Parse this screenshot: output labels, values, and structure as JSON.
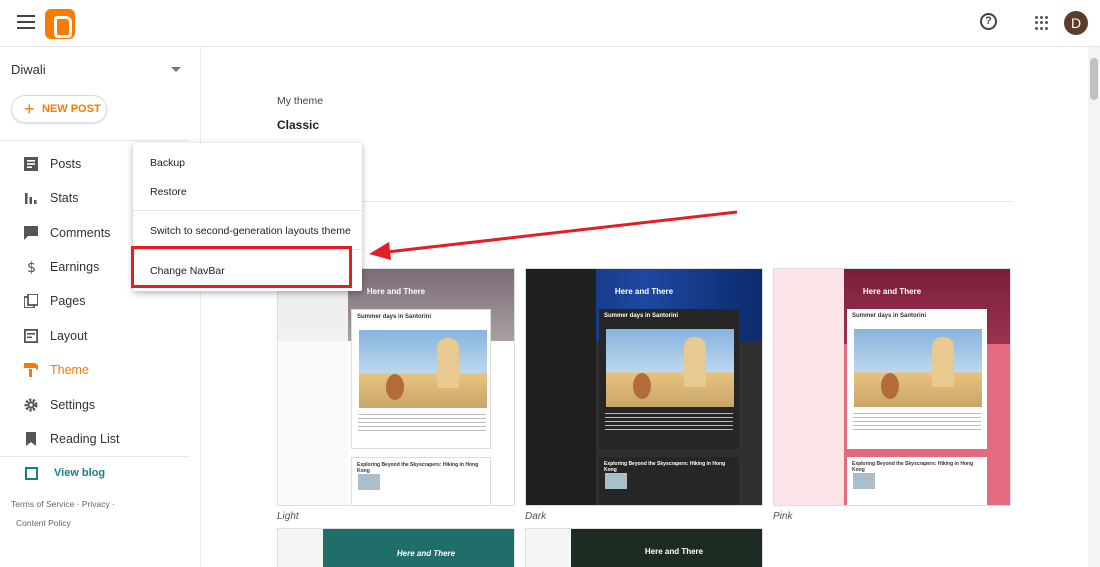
{
  "header": {
    "help_label": "?",
    "user_initial": "D"
  },
  "sidebar": {
    "blog_name": "Diwali",
    "new_post_label": "NEW POST",
    "items": [
      {
        "label": "Posts",
        "icon": "posts-icon",
        "active": false
      },
      {
        "label": "Stats",
        "icon": "stats-icon",
        "active": false
      },
      {
        "label": "Comments",
        "icon": "comments-icon",
        "active": false
      },
      {
        "label": "Earnings",
        "icon": "dollar-icon",
        "active": false
      },
      {
        "label": "Pages",
        "icon": "pages-icon",
        "active": false
      },
      {
        "label": "Layout",
        "icon": "layout-icon",
        "active": false
      },
      {
        "label": "Theme",
        "icon": "paint-roller-icon",
        "active": true
      },
      {
        "label": "Settings",
        "icon": "gear-icon",
        "active": false
      },
      {
        "label": "Reading List",
        "icon": "bookmark-icon",
        "active": false
      }
    ],
    "view_blog_label": "View blog",
    "footer": {
      "terms": "Terms of Service",
      "privacy": "Privacy",
      "content_policy": "Content Policy",
      "dot": "·"
    }
  },
  "main": {
    "my_theme_label": "My theme",
    "theme_name": "Classic",
    "themes": [
      {
        "label": "Light",
        "title": "Here and There",
        "post_title": "Summer days in Santorini",
        "post2_title": "Exploring Beyond the Skyscrapers: Hiking in Hong Kong"
      },
      {
        "label": "Dark",
        "title": "Here and There",
        "post_title": "Summer days in Santorini",
        "post2_title": "Exploring Beyond the Skyscrapers: Hiking in Hong Kong"
      },
      {
        "label": "Pink",
        "title": "Here and There",
        "post_title": "Summer days in Santorini",
        "post2_title": "Exploring Beyond the Skyscrapers: Hiking in Hong Kong"
      }
    ],
    "bottom_themes": [
      {
        "title": "Here and There"
      },
      {
        "title": "Here and There"
      }
    ]
  },
  "menu": {
    "items": [
      "Backup",
      "Restore",
      "Switch to second-generation layouts theme",
      "Change NavBar"
    ]
  },
  "colors": {
    "accent": "#f57c00",
    "highlight": "#e31e24",
    "link": "#1a7f87"
  }
}
